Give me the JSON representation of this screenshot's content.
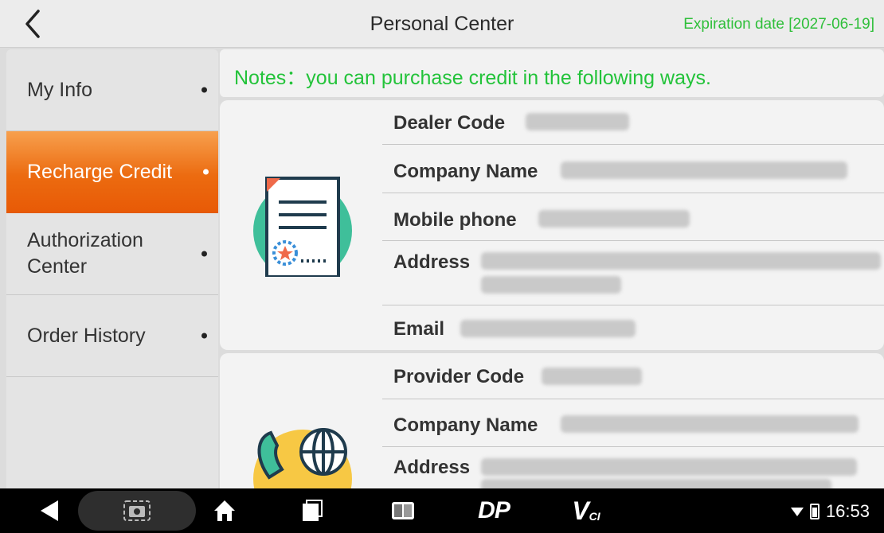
{
  "header": {
    "title": "Personal Center",
    "expiration": "Expiration date [2027-06-19]"
  },
  "sidebar": {
    "items": [
      {
        "label": "My Info",
        "active": false
      },
      {
        "label": "Recharge Credit",
        "active": true
      },
      {
        "label": "Authorization Center",
        "active": false
      },
      {
        "label": "Order History",
        "active": false
      }
    ]
  },
  "notes": "Notes：you can purchase credit in the following ways.",
  "dealer": {
    "dealer_code_label": "Dealer Code",
    "company_name_label": "Company Name",
    "mobile_phone_label": "Mobile phone",
    "address_label": "Address",
    "email_label": "Email"
  },
  "provider": {
    "provider_code_label": "Provider Code",
    "company_name_label": "Company Name",
    "address_label": "Address"
  },
  "systembar": {
    "dp_label": "DP",
    "vci_label": "V",
    "vci_sub": "CI",
    "time": "16:53"
  },
  "colors": {
    "accent_green": "#2fbf3a",
    "active_orange": "#ec6b10",
    "icon_teal": "#3fbf9a"
  }
}
